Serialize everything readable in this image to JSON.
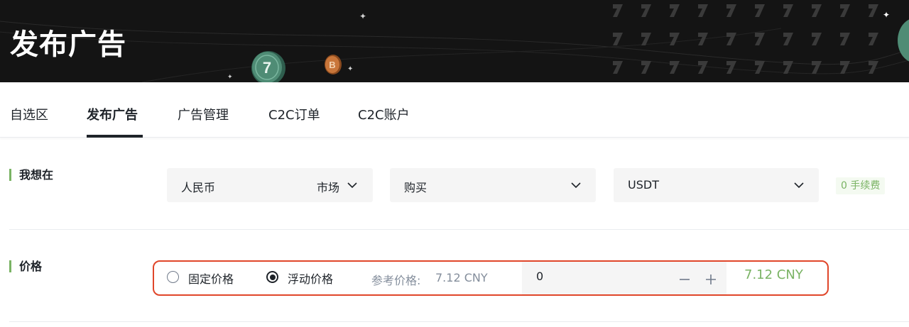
{
  "banner": {
    "title": "发布广告",
    "coin_glyph": "7",
    "bitcoin_glyph": "B"
  },
  "tabs": [
    {
      "label": "自选区",
      "active": false
    },
    {
      "label": "发布广告",
      "active": true
    },
    {
      "label": "广告管理",
      "active": false
    },
    {
      "label": "C2C订单",
      "active": false
    },
    {
      "label": "C2C账户",
      "active": false
    }
  ],
  "want": {
    "label": "我想在",
    "fiat": {
      "value": "人民币",
      "market": "市场"
    },
    "side": {
      "value": "购买"
    },
    "asset": {
      "value": "USDT"
    },
    "fee_badge": "0 手续费"
  },
  "price": {
    "label": "价格",
    "fixed_label": "固定价格",
    "fixed_selected": false,
    "floating_label": "浮动价格",
    "floating_selected": true,
    "ref_label": "参考价格:",
    "ref_value": "7.12 CNY",
    "input_value": "0",
    "result": "7.12 CNY"
  },
  "colors": {
    "accent_green": "#7ab364",
    "highlight_red": "#e0462a",
    "banner_bg": "#141414"
  }
}
